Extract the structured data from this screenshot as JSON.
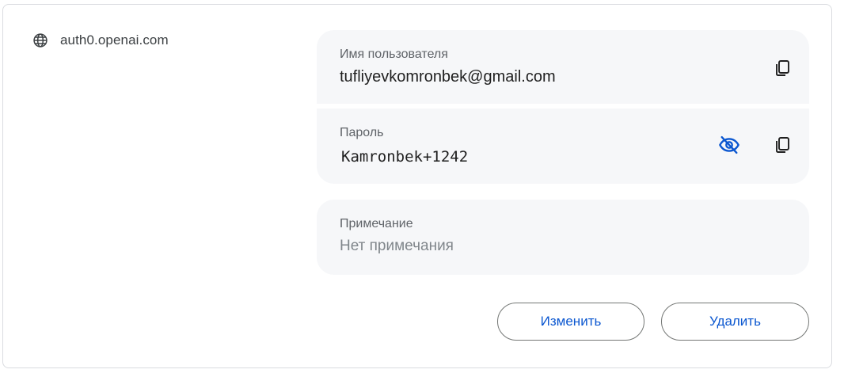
{
  "site": {
    "icon": "globe-icon",
    "label": "auth0.openai.com"
  },
  "username": {
    "label": "Имя пользователя",
    "value": "tufliyevkomronbek@gmail.com",
    "copy_icon": "copy-icon"
  },
  "password": {
    "label": "Пароль",
    "value": "Kamronbek+1242",
    "visibility_icon": "eye-off-icon",
    "copy_icon": "copy-icon"
  },
  "note": {
    "label": "Примечание",
    "placeholder": "Нет примечания"
  },
  "actions": {
    "edit_label": "Изменить",
    "delete_label": "Удалить"
  },
  "colors": {
    "accent": "#0b57d0",
    "field_bg": "#f6f7f9",
    "border": "#dadce0"
  }
}
